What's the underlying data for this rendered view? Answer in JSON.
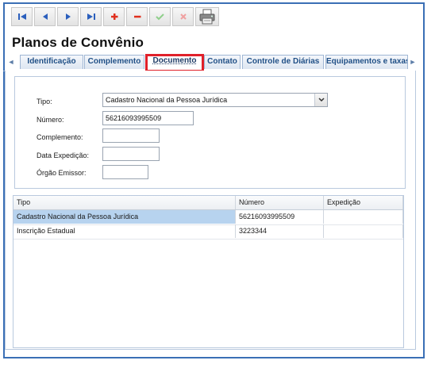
{
  "page": {
    "title": "Planos de Convênio"
  },
  "toolbar": {
    "buttons": [
      {
        "icon": "first-record-icon",
        "color": "#2b5fbd"
      },
      {
        "icon": "previous-record-icon",
        "color": "#2b5fbd"
      },
      {
        "icon": "next-record-icon",
        "color": "#2b5fbd"
      },
      {
        "icon": "last-record-icon",
        "color": "#2b5fbd"
      },
      {
        "icon": "add-icon",
        "color": "#e0301e"
      },
      {
        "icon": "remove-icon",
        "color": "#e0301e"
      },
      {
        "icon": "confirm-icon",
        "color": "#8fcf8a"
      },
      {
        "icon": "cancel-icon",
        "color": "#f0a0a0"
      },
      {
        "icon": "printer-icon",
        "color": "#555555"
      }
    ]
  },
  "tabs": [
    {
      "label": "Identificação",
      "active": false
    },
    {
      "label": "Complemento",
      "active": false
    },
    {
      "label": "Documento",
      "active": true
    },
    {
      "label": "Contato",
      "active": false
    },
    {
      "label": "Controle de Diárias",
      "active": false
    },
    {
      "label": "Equipamentos e taxas",
      "active": false
    }
  ],
  "form": {
    "tipo": {
      "label": "Tipo:",
      "value": "Cadastro Nacional da Pessoa Jurídica"
    },
    "numero": {
      "label": "Número:",
      "value": "56216093995509"
    },
    "complemento": {
      "label": "Complemento:",
      "value": ""
    },
    "data_expedicao": {
      "label": "Data Expedição:",
      "value": ""
    },
    "orgao_emissor": {
      "label": "Órgão Emissor:",
      "value": ""
    }
  },
  "grid": {
    "columns": [
      "Tipo",
      "Número",
      "Expedição"
    ],
    "rows": [
      {
        "tipo": "Cadastro Nacional da Pessoa Jurídica",
        "numero": "56216093995509",
        "expedicao": "",
        "selected": true
      },
      {
        "tipo": "Inscrição Estadual",
        "numero": "3223344",
        "expedicao": "",
        "selected": false
      }
    ]
  },
  "colors": {
    "highlight_box": "#e0202a",
    "selected_row": "#b7d3ef",
    "frame_border": "#3a6fb5"
  }
}
